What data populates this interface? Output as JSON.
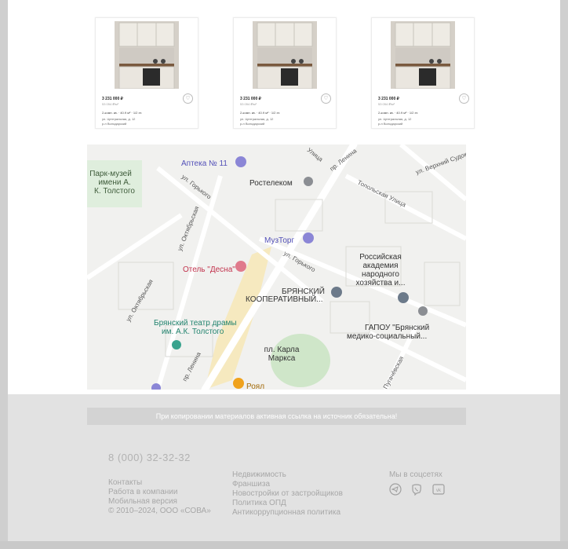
{
  "listings": [
    {
      "price": "3 231 000 ₽",
      "price_per_m": "53 054 ₽/м²",
      "params": "2-комн. кв. · 40.9 м² · 1/2 эт.",
      "address": "ул. Центральная, д. 12",
      "district": "р-н Володарский"
    },
    {
      "price": "3 231 000 ₽",
      "price_per_m": "53 054 ₽/м²",
      "params": "2-комн. кв. · 40.9 м² · 1/2 эт.",
      "address": "ул. Центральная, д. 12",
      "district": "р-н Володарский"
    },
    {
      "price": "3 231 000 ₽",
      "price_per_m": "53 054 ₽/м²",
      "params": "2-комн. кв. · 40.9 м² · 1/2 эт.",
      "address": "ул. Центральная, д. 12",
      "district": "р-н Володарский"
    }
  ],
  "map": {
    "labels": {
      "park": [
        "Парк-музей",
        "имени А.",
        "К. Толстого"
      ],
      "pharmacy": "Аптека № 11",
      "rostelecom": "Ростелеком",
      "muztorg": "МузТорг",
      "hotel": "Отель \"Десна\"",
      "coop": [
        "БРЯНСКИЙ",
        "КООПЕРАТИВНЫЙ..."
      ],
      "academy": [
        "Российская",
        "академия",
        "народного",
        "хозяйства и..."
      ],
      "gapou": [
        "ГАПОУ \"Брянский",
        "медико-социальный..."
      ],
      "theatre": [
        "Брянский театр драмы",
        "им. А.К. Толстого"
      ],
      "square": [
        "пл. Карла",
        "Маркса"
      ],
      "royal": "Роял",
      "streets": {
        "ulitsa": "Улица",
        "lenina_top": "пр. Ленина",
        "gorkogo_left": "ул. Горького",
        "oktyabrskaya_top": "ул. Октябрьская",
        "oktyabrskaya_bottom": "ул. Октябрьская",
        "topolskaya": "Топольская Улица",
        "verkhny_sudok": "ул. Верхний Судок",
        "gorkogo_mid": "ул. Горького",
        "lenina_bottom": "пр. Ленина",
        "pugachevskaya": "Пугачёвская"
      }
    }
  },
  "footer": {
    "notice": "При копировании материалов активная ссылка на источник обязательна!",
    "phone": "8 (000) 32-32-32",
    "col1": [
      "Контакты",
      "Работа в компании",
      "Мобильная версия",
      "© 2010–2024, ООО «СОВА»"
    ],
    "col2": [
      "Недвижимость",
      "Франшиза",
      "Новостройки от застройщиков",
      "Политика ОПД",
      "Антикоррупционная политика"
    ],
    "social_title": "Мы в соцсетях",
    "social_icons": [
      "telegram-icon",
      "viber-icon",
      "vk-icon"
    ]
  }
}
